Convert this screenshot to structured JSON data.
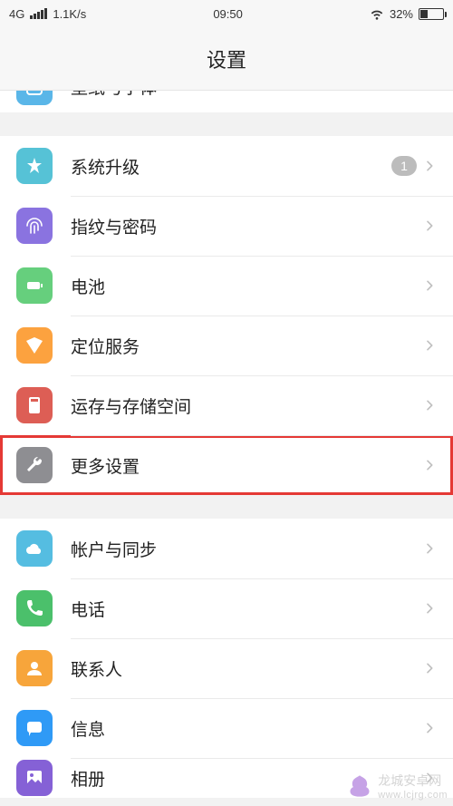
{
  "status": {
    "network_type": "4G",
    "data_rate": "1.1K/s",
    "time": "09:50",
    "battery_pct": "32%"
  },
  "title": "设置",
  "groups": [
    {
      "cut_top": true,
      "items": [
        {
          "key": "wallpaper",
          "label": "壁纸与字体",
          "icon": "app-icon",
          "icon_class": "ic-app"
        }
      ]
    },
    {
      "items": [
        {
          "key": "update",
          "label": "系统升级",
          "icon": "update-icon",
          "icon_class": "ic-update",
          "badge": "1"
        },
        {
          "key": "finger",
          "label": "指纹与密码",
          "icon": "fingerprint-icon",
          "icon_class": "ic-finger"
        },
        {
          "key": "battery",
          "label": "电池",
          "icon": "battery-icon",
          "icon_class": "ic-battery"
        },
        {
          "key": "location",
          "label": "定位服务",
          "icon": "location-icon",
          "icon_class": "ic-location"
        },
        {
          "key": "storage",
          "label": "运存与存储空间",
          "icon": "storage-icon",
          "icon_class": "ic-storage"
        },
        {
          "key": "more",
          "label": "更多设置",
          "icon": "wrench-icon",
          "icon_class": "ic-more",
          "highlighted": true
        }
      ]
    },
    {
      "items": [
        {
          "key": "account",
          "label": "帐户与同步",
          "icon": "cloud-icon",
          "icon_class": "ic-account"
        },
        {
          "key": "phone",
          "label": "电话",
          "icon": "phone-icon",
          "icon_class": "ic-phone"
        },
        {
          "key": "contacts",
          "label": "联系人",
          "icon": "contacts-icon",
          "icon_class": "ic-contacts"
        },
        {
          "key": "message",
          "label": "信息",
          "icon": "message-icon",
          "icon_class": "ic-message"
        },
        {
          "key": "gallery",
          "label": "相册",
          "icon": "gallery-icon",
          "icon_class": "ic-gallery",
          "partial_bottom": true
        }
      ]
    }
  ],
  "watermark": {
    "text": "龙城安卓网",
    "sub": "www.lcjrg.com"
  }
}
